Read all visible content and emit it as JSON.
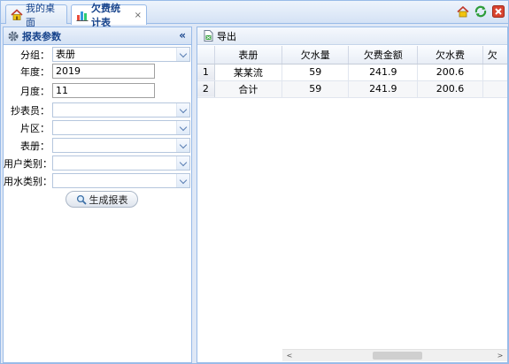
{
  "tabs": [
    {
      "label": "我的桌面",
      "icon": "home-icon"
    },
    {
      "label": "欠费统计表",
      "icon": "chart-icon",
      "close": "×"
    }
  ],
  "header_tools": [
    "home-icon",
    "refresh-icon",
    "close-icon"
  ],
  "left_panel": {
    "title": "报表参数",
    "collapse": "«",
    "fields": [
      {
        "label": "分组：",
        "type": "combo",
        "value": "表册"
      },
      {
        "label": "年度：",
        "type": "text",
        "value": "2019"
      },
      {
        "label": "月度：",
        "type": "text",
        "value": "11"
      },
      {
        "label": "抄表员：",
        "type": "combo",
        "value": ""
      },
      {
        "label": "片区：",
        "type": "combo",
        "value": ""
      },
      {
        "label": "表册：",
        "type": "combo",
        "value": ""
      },
      {
        "label": "用户类别：",
        "type": "combo",
        "value": ""
      },
      {
        "label": "用水类别：",
        "type": "combo",
        "value": ""
      }
    ],
    "generate_label": "生成报表"
  },
  "right_panel": {
    "export_label": "导出",
    "columns": [
      "",
      "表册",
      "欠水量",
      "欠费金额",
      "欠水费",
      "欠"
    ],
    "rows": [
      [
        "1",
        "某某流",
        "59",
        "241.9",
        "200.6"
      ],
      [
        "2",
        "合计",
        "59",
        "241.9",
        "200.6"
      ]
    ],
    "scroll_left": "<",
    "scroll_right": ">"
  }
}
